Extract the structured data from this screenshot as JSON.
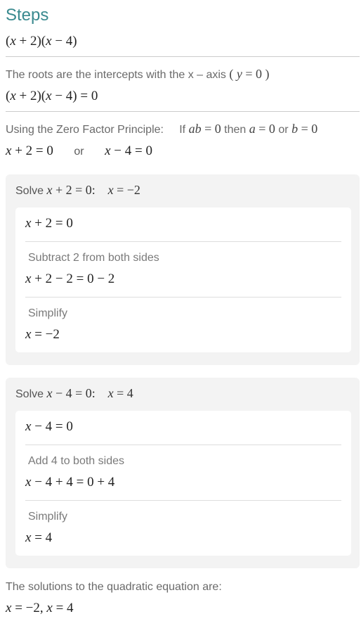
{
  "heading": "Steps",
  "expr_top": "(x + 2)(x − 4)",
  "roots_intro": "The roots are the intercepts with the x – axis",
  "roots_cond": "(y = 0)",
  "eq_zero": "(x + 2)(x − 4) = 0",
  "zfp_label": "Using the Zero Factor Principle:",
  "zfp_if": "If",
  "zfp_ab": "ab = 0",
  "zfp_then": "then",
  "zfp_a": "a = 0",
  "zfp_or": "or",
  "zfp_b": "b = 0",
  "split_left": "x + 2 = 0",
  "split_or": "or",
  "split_right": "x − 4 = 0",
  "solve1": {
    "head_label": "Solve",
    "head_eq": "x + 2 = 0:",
    "head_ans": "x = −2",
    "line1": "x + 2 = 0",
    "step1_text": "Subtract 2 from both sides",
    "step1_eq": "x + 2 − 2 = 0 − 2",
    "step2_text": "Simplify",
    "step2_eq": "x = −2"
  },
  "solve2": {
    "head_label": "Solve",
    "head_eq": "x − 4 = 0:",
    "head_ans": "x = 4",
    "line1": "x − 4 = 0",
    "step1_text": "Add 4 to both sides",
    "step1_eq": "x − 4 + 4 = 0 + 4",
    "step2_text": "Simplify",
    "step2_eq": "x = 4"
  },
  "final_text": "The solutions to the quadratic equation are:",
  "final_eq": "x = −2, x = 4"
}
